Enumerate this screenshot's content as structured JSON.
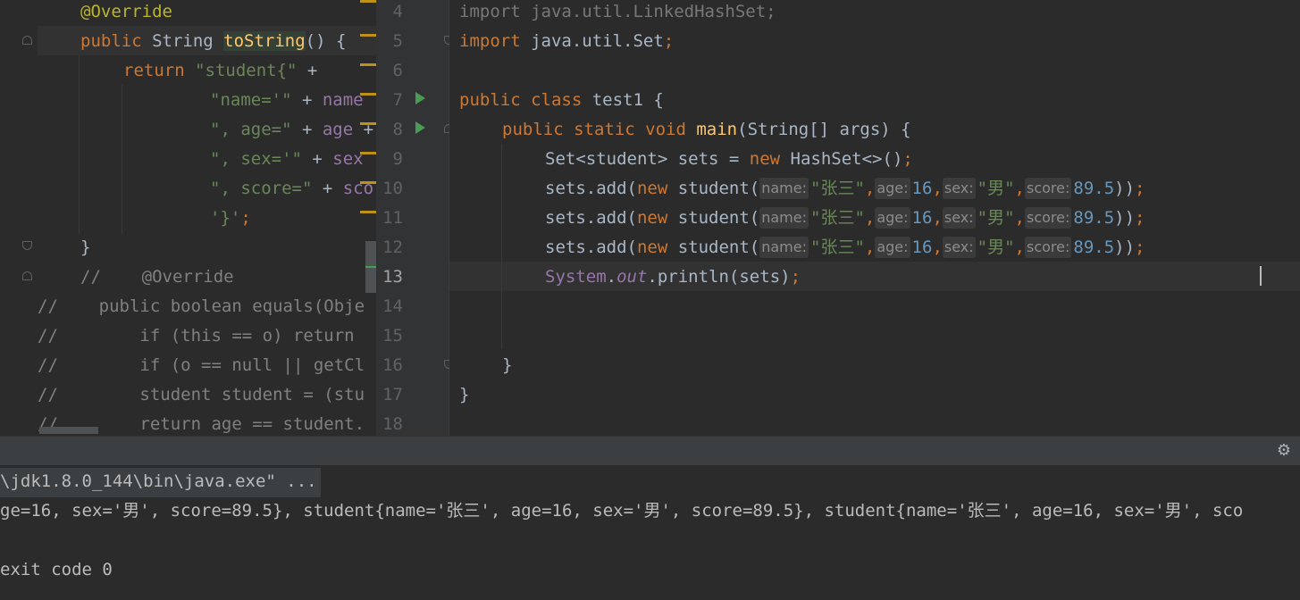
{
  "left_editor": {
    "lines": [
      {
        "text": "@Override"
      },
      {
        "text": "public String toString() {"
      },
      {
        "text": "return \"student{\" +"
      },
      {
        "text": "\"name='\" + name"
      },
      {
        "text": "\", age=\" + age +"
      },
      {
        "text": "\", sex='\" + sex"
      },
      {
        "text": "\", score=\" + sco"
      },
      {
        "text": "'}';"
      },
      {
        "text": "}"
      },
      {
        "text": "//    @Override"
      },
      {
        "text": "//    public boolean equals(Obje"
      },
      {
        "text": "//        if (this == o) return"
      },
      {
        "text": "//        if (o == null || getCl"
      },
      {
        "text": "//        student student = (stu"
      },
      {
        "text": "//        return age == student."
      }
    ],
    "override_marker": "↑"
  },
  "right_editor": {
    "line_numbers": [
      "4",
      "5",
      "6",
      "7",
      "8",
      "9",
      "10",
      "11",
      "12",
      "13",
      "14",
      "15",
      "16",
      "17",
      "18"
    ],
    "current_line": "13",
    "code": {
      "l4": "import java.util.LinkedHashSet;",
      "l5_kw": "import",
      "l5_rest": " java.util.Set",
      "l7_kw": "public class",
      "l7_rest": " test1 {",
      "l8_kw": "public static void",
      "l8_fn": "main",
      "l8_rest": "(String[] args) {",
      "l9_a": "Set<student> sets = ",
      "l9_kw": "new",
      "l9_b": " HashSet<>()",
      "add_prefix": "sets.add(",
      "add_kw": "new",
      "add_cls": " student(",
      "hint_name": "name:",
      "hint_age": "age:",
      "hint_sex": "sex:",
      "hint_score": "score:",
      "arg_name": "\"张三\"",
      "arg_age": "16",
      "arg_sex": "\"男\"",
      "arg_score": "89.5",
      "add_close": "))",
      "l13_sys": "System",
      "l13_dot": ".",
      "l13_out": "out",
      "l13_rest": ".println(sets)",
      "semi": ";",
      "comma": ",",
      "close_brace": "}"
    }
  },
  "console": {
    "command": "\\jdk1.8.0_144\\bin\\java.exe\" ...",
    "output": "ge=16, sex='男', score=89.5}, student{name='张三', age=16, sex='男', score=89.5}, student{name='张三', age=16, sex='男', sco",
    "exit": "exit code 0"
  },
  "icons": {
    "settings": "gear-icon"
  },
  "colors": {
    "keyword": "#cc7832",
    "string": "#6a8759",
    "number": "#6897bb",
    "annotation": "#bbb529",
    "field": "#9876aa",
    "method": "#ffc66d"
  }
}
